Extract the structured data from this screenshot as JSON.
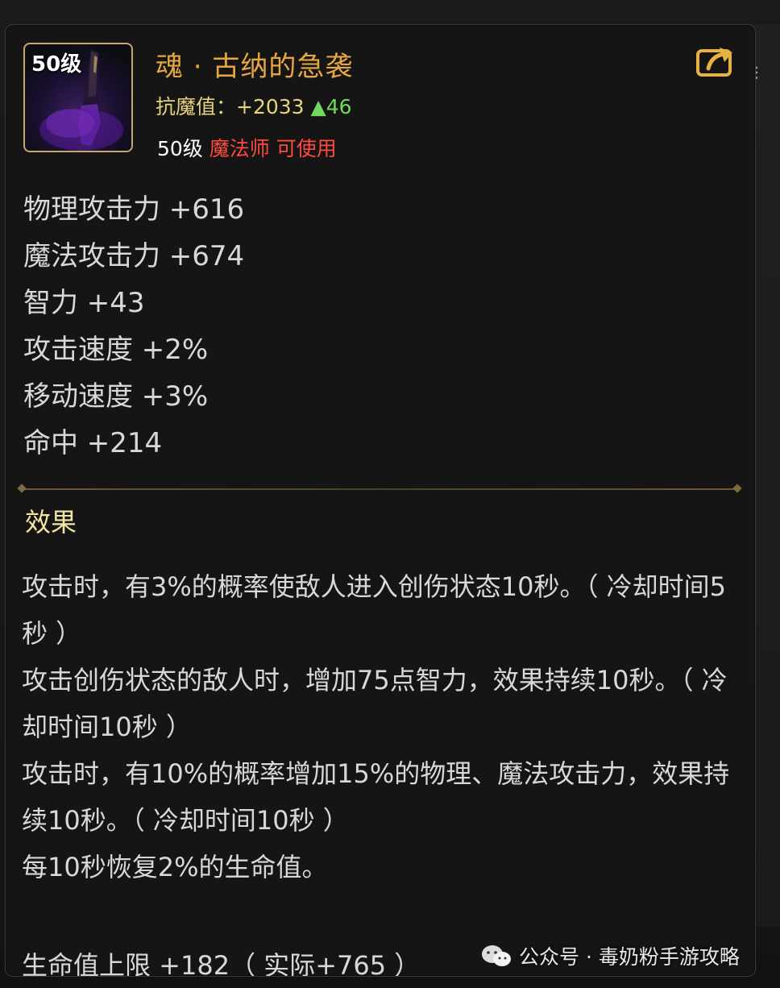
{
  "item": {
    "icon_level": "50级",
    "name": "魂 · 古纳的急袭",
    "stat_label": "抗魔值：+2033",
    "stat_delta": "▲46",
    "req_level": "50级",
    "req_class": "魔法师 可使用"
  },
  "attributes": [
    "物理攻击力 +616",
    "魔法攻击力 +674",
    "智力 +43",
    "攻击速度 +2%",
    "移动速度 +3%",
    "命中 +214"
  ],
  "effects": {
    "title": "效果",
    "lines": [
      "攻击时，有3%的概率使敌人进入创伤状态10秒。（ 冷却时间5秒 ）",
      "攻击创伤状态的敌人时，增加75点智力，效果持续10秒。（ 冷却时间10秒 ）",
      "攻击时，有10%的概率增加15%的物理、魔法攻击力，效果持续10秒。（ 冷却时间10秒 ）",
      "每10秒恢复2%的生命值。"
    ],
    "partial_line": "生命值上限 +182（ 实际+765 ）"
  },
  "watermark": "公众号 · 毒奶粉手游攻略",
  "colors": {
    "title": "#e6a640",
    "stat": "#e8d27a",
    "stat_up": "#6fdb5c",
    "class_req": "#ff4a3c",
    "effect_title": "#f2e6a0",
    "border_gold": "#c9a66b"
  },
  "icons": [
    "item-weapon-icon",
    "share-icon",
    "wechat-icon"
  ]
}
